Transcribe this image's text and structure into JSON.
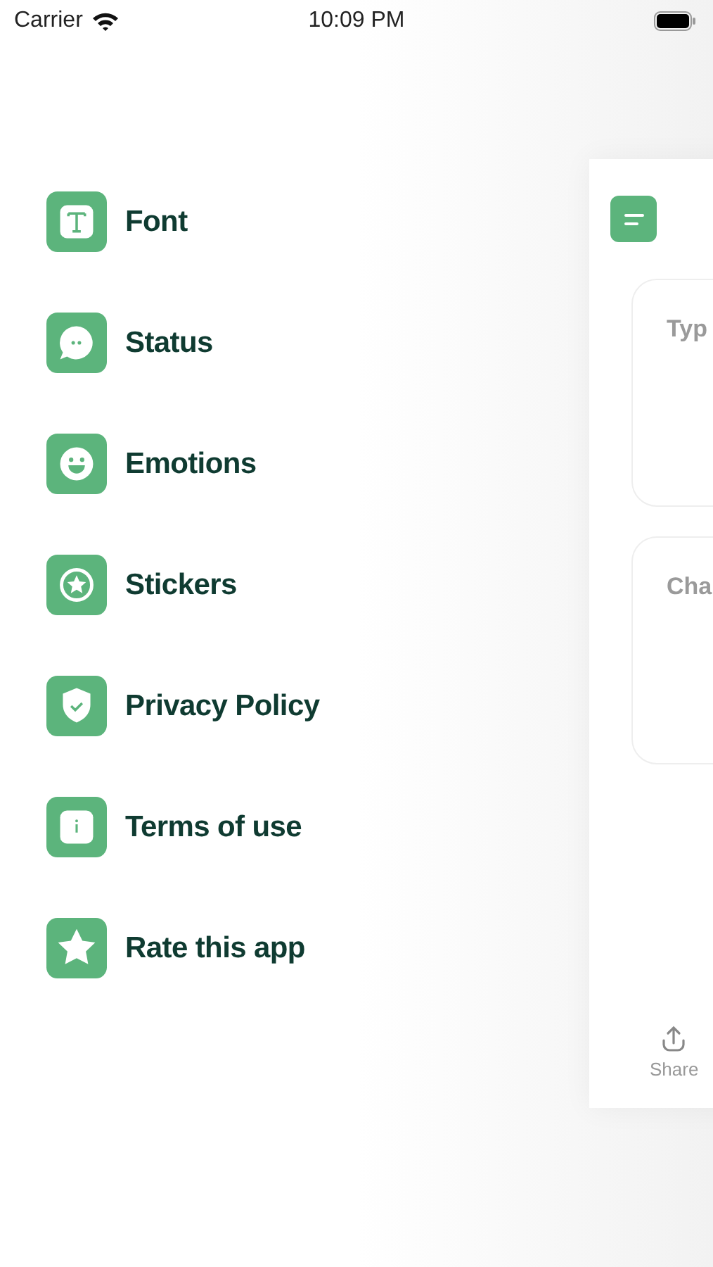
{
  "status_bar": {
    "carrier": "Carrier",
    "time": "10:09 PM"
  },
  "menu": [
    {
      "kind": "font",
      "label": "Font"
    },
    {
      "kind": "status",
      "label": "Status"
    },
    {
      "kind": "emotions",
      "label": "Emotions"
    },
    {
      "kind": "stickers",
      "label": "Stickers"
    },
    {
      "kind": "privacy",
      "label": "Privacy Policy"
    },
    {
      "kind": "terms",
      "label": "Terms of use"
    },
    {
      "kind": "rate",
      "label": "Rate this app"
    }
  ],
  "main": {
    "cards": [
      {
        "placeholder": "Typ"
      },
      {
        "placeholder": "Cha"
      }
    ],
    "toolbar": [
      {
        "label": "Share"
      }
    ]
  }
}
